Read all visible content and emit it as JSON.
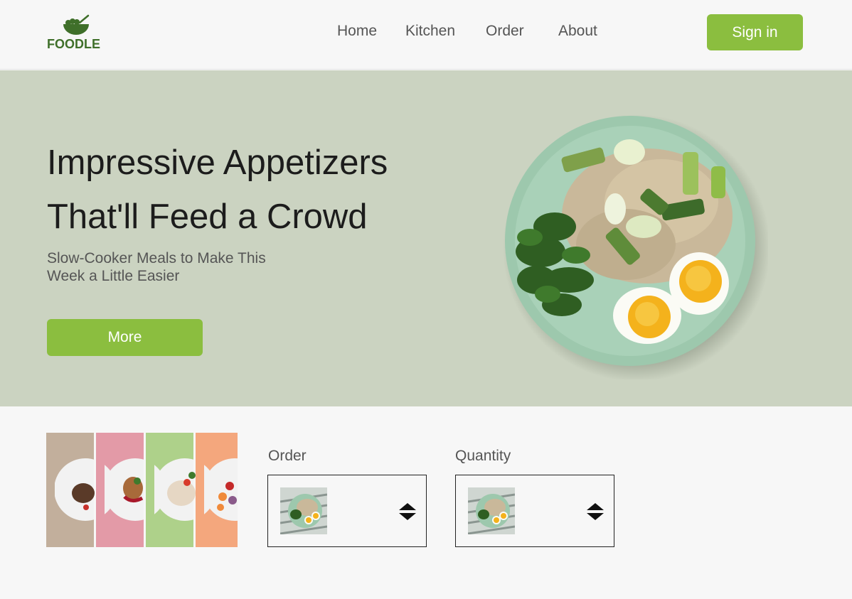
{
  "brand": {
    "name": "FOODLE",
    "color": "#3f6f2a"
  },
  "nav": {
    "items": [
      {
        "label": "Home"
      },
      {
        "label": "Kitchen"
      },
      {
        "label": "Order"
      },
      {
        "label": "About"
      }
    ],
    "signin_label": "Sign in"
  },
  "hero": {
    "title_line1": "Impressive Appetizers",
    "title_line2": "That'll Feed a Crowd",
    "subtitle_line1": "Slow-Cooker Meals to Make This",
    "subtitle_line2": "Week a Little Easier",
    "more_label": "More",
    "image_icon": "rice-bowl-with-eggs-image",
    "background": "#cbd3c1"
  },
  "gallery": {
    "panels": [
      {
        "color": "#c2af9c",
        "dish": "steak"
      },
      {
        "color": "#e39aa7",
        "dish": "chicken"
      },
      {
        "color": "#aed18a",
        "dish": "sliced-meat"
      },
      {
        "color": "#f4a77d",
        "dish": "shrimp"
      }
    ]
  },
  "order_field": {
    "label": "Order",
    "icon": "up-down-arrows-icon"
  },
  "quantity_field": {
    "label": "Quantity",
    "icon": "up-down-arrows-icon"
  },
  "colors": {
    "accent": "#8bbe3f",
    "text": "#555555",
    "page": "#f7f7f7"
  }
}
